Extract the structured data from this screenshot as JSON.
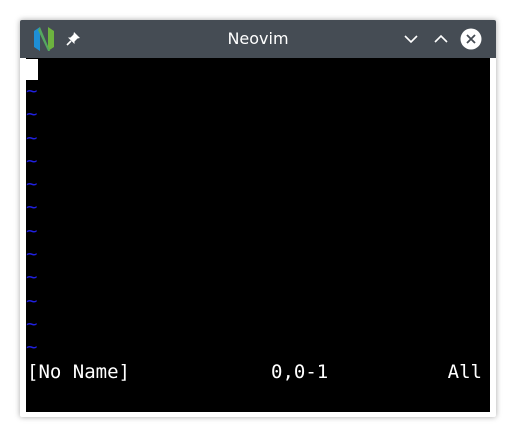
{
  "window": {
    "title": "Neovim",
    "controls": [
      "minimize-icon",
      "maximize-icon",
      "close-icon"
    ]
  },
  "editor": {
    "empty_line_marker": "~",
    "empty_lines": [
      "~",
      "~",
      "~",
      "~",
      "~",
      "~",
      "~",
      "~",
      "~",
      "~",
      "~",
      "~"
    ],
    "status": {
      "file": "[No Name]",
      "position": "0,0-1",
      "scroll": "All"
    }
  },
  "colors": {
    "titlebar": "#454c54",
    "background": "#000000",
    "text": "#ffffff",
    "tilde": "#2020e0"
  }
}
